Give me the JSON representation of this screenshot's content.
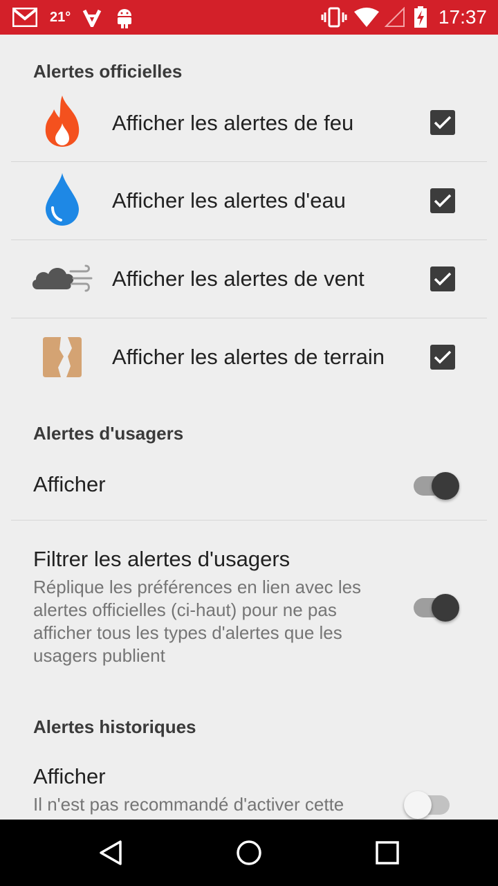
{
  "status_bar": {
    "temperature": "21°",
    "time": "17:37",
    "icons": [
      "gmail-icon",
      "feedly-icon",
      "android-icon",
      "vibrate-icon",
      "wifi-icon",
      "signal-icon",
      "battery-charging-icon"
    ]
  },
  "sections": {
    "official": {
      "header": "Alertes officielles",
      "items": [
        {
          "label": "Afficher les alertes de feu",
          "icon": "fire-icon",
          "checked": true
        },
        {
          "label": "Afficher les alertes d'eau",
          "icon": "water-drop-icon",
          "checked": true
        },
        {
          "label": "Afficher les alertes de vent",
          "icon": "wind-cloud-icon",
          "checked": true
        },
        {
          "label": "Afficher les alertes de terrain",
          "icon": "terrain-icon",
          "checked": true
        }
      ]
    },
    "users": {
      "header": "Alertes d'usagers",
      "show": {
        "title": "Afficher",
        "enabled": true
      },
      "filter": {
        "title": "Filtrer les alertes d'usagers",
        "summary": "Réplique les préférences en lien avec les alertes officielles (ci-haut) pour ne pas afficher tous les types d'alertes que les usagers publient",
        "enabled": true
      }
    },
    "historical": {
      "header": "Alertes historiques",
      "show": {
        "title": "Afficher",
        "summary": "Il n'est pas recommandé d'activer cette",
        "enabled": false
      }
    }
  },
  "colors": {
    "status_bar": "#d32029",
    "fire": "#f4511e",
    "water": "#1e88e5",
    "terrain": "#d4a373"
  }
}
